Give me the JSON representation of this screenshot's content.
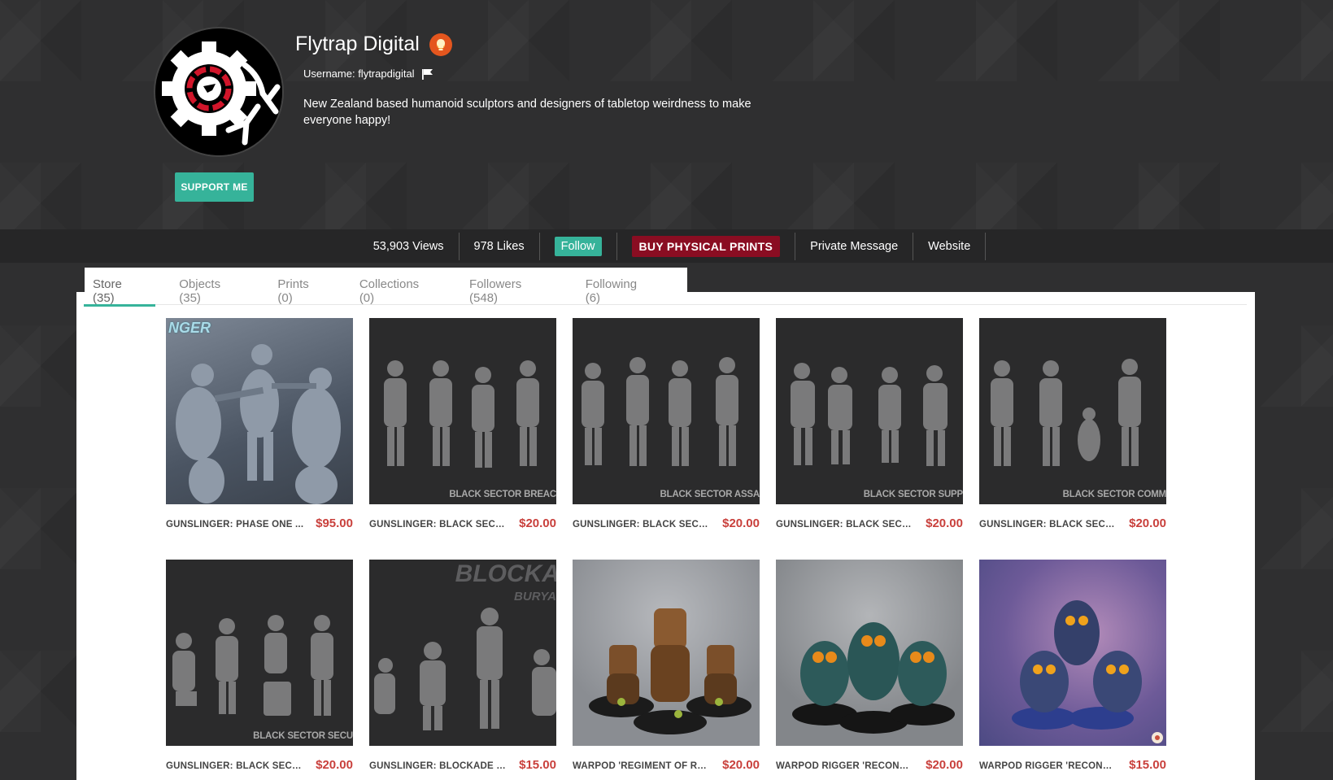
{
  "profile": {
    "name": "Flytrap Digital",
    "username_label": "Username: flytrapdigital",
    "bio": "New Zealand based humanoid sculptors and designers of tabletop weirdness to make everyone happy!",
    "support_label": "SUPPORT ME"
  },
  "stats": {
    "views": "53,903 Views",
    "likes": "978 Likes",
    "follow_label": "Follow",
    "prints_label": "BUY PHYSICAL PRINTS",
    "message_label": "Private Message",
    "website_label": "Website"
  },
  "tabs": [
    {
      "label": "Store (35)",
      "active": true
    },
    {
      "label": "Objects (35)"
    },
    {
      "label": "Prints (0)"
    },
    {
      "label": "Collections (0)"
    },
    {
      "label": "Followers (548)"
    },
    {
      "label": "Following (6)"
    }
  ],
  "products": [
    {
      "title": "GUNSLINGER: PHASE ONE ...",
      "price": "$95.00",
      "image_text": "NGER"
    },
    {
      "title": "GUNSLINGER: BLACK SECTO...",
      "price": "$20.00",
      "image_text": "BLACK SECTOR BREAC"
    },
    {
      "title": "GUNSLINGER: BLACK SECTO...",
      "price": "$20.00",
      "image_text": "BLACK SECTOR ASSA"
    },
    {
      "title": "GUNSLINGER: BLACK SECTO...",
      "price": "$20.00",
      "image_text": "BLACK SECTOR SUPP"
    },
    {
      "title": "GUNSLINGER: BLACK SECTO...",
      "price": "$20.00",
      "image_text": "BLACK SECTOR COMM"
    },
    {
      "title": "GUNSLINGER: BLACK SECTO...",
      "price": "$20.00",
      "image_text": "BLACK SECTOR SECU"
    },
    {
      "title": "GUNSLINGER: BLOCKADE 'B...",
      "price": "$15.00",
      "image_text": "BLOCKA",
      "image_text_sub": "BURYA"
    },
    {
      "title": "WARPOD 'REGIMENT OF RU...",
      "price": "$20.00"
    },
    {
      "title": "WARPOD RIGGER 'RECOND...",
      "price": "$20.00"
    },
    {
      "title": "WARPOD RIGGER 'RECOND...",
      "price": "$15.00"
    }
  ],
  "colors": {
    "accent": "#36b39a",
    "prints": "#8a0d22",
    "price": "#c9403c",
    "background": "#2f2f30"
  }
}
